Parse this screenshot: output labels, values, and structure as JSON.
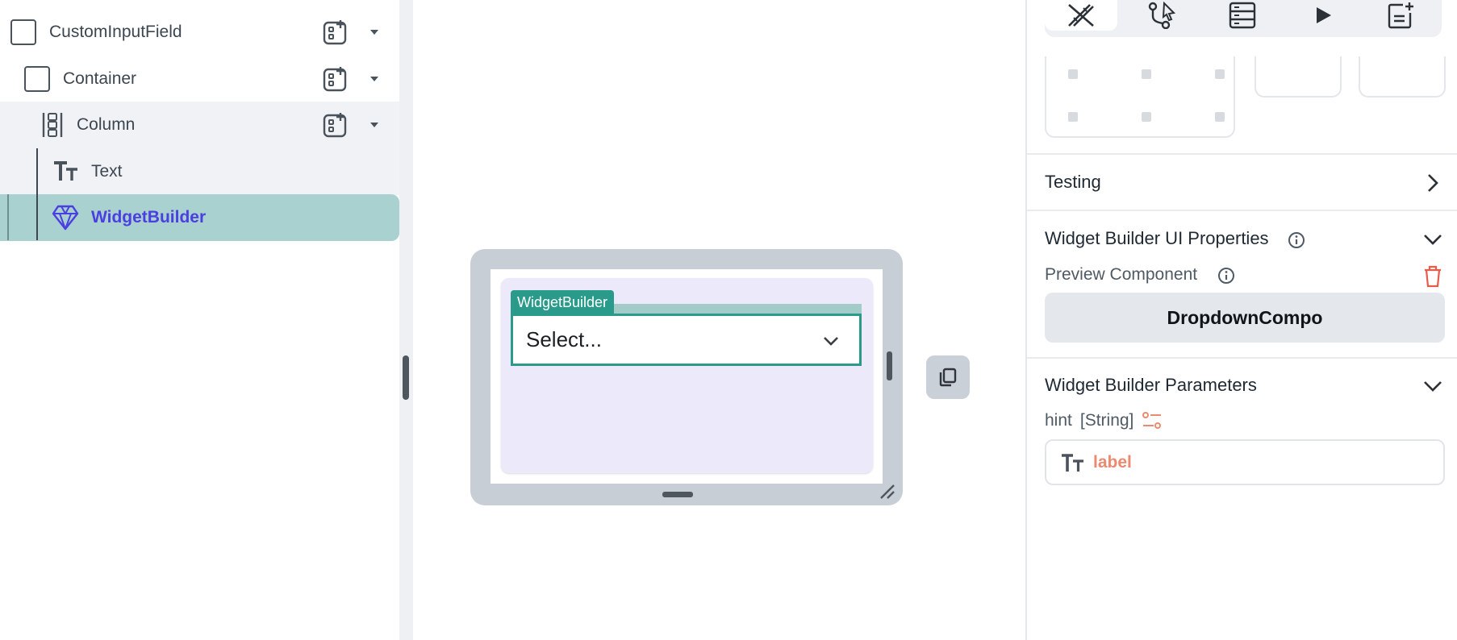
{
  "tree": {
    "items": [
      {
        "label": "CustomInputField",
        "icon": "container-icon"
      },
      {
        "label": "Container",
        "icon": "container-icon"
      },
      {
        "label": "Column",
        "icon": "column-icon"
      },
      {
        "label": "Text",
        "icon": "text-icon"
      },
      {
        "label": "WidgetBuilder",
        "icon": "widget-builder-icon"
      }
    ]
  },
  "canvas": {
    "widget_tag": "WidgetBuilder",
    "dropdown_value": "Select..."
  },
  "right_panel": {
    "tabs": [
      "properties-tab",
      "actions-tab",
      "backend-query-tab",
      "run-tab",
      "notes-tab"
    ],
    "testing_title": "Testing",
    "ui_properties_title": "Widget Builder UI Properties",
    "preview_label": "Preview Component",
    "preview_value": "DropdownCompo",
    "parameters_title": "Widget Builder Parameters",
    "param_name": "hint",
    "param_type": "[String]",
    "param_value": "label"
  },
  "colors": {
    "selected_row": "#a8d1cf",
    "selected_text": "#4b3fe0",
    "teal_accent": "#2a9a8b",
    "param_accent": "#ec8a6f",
    "trash_red": "#e85c4a"
  }
}
